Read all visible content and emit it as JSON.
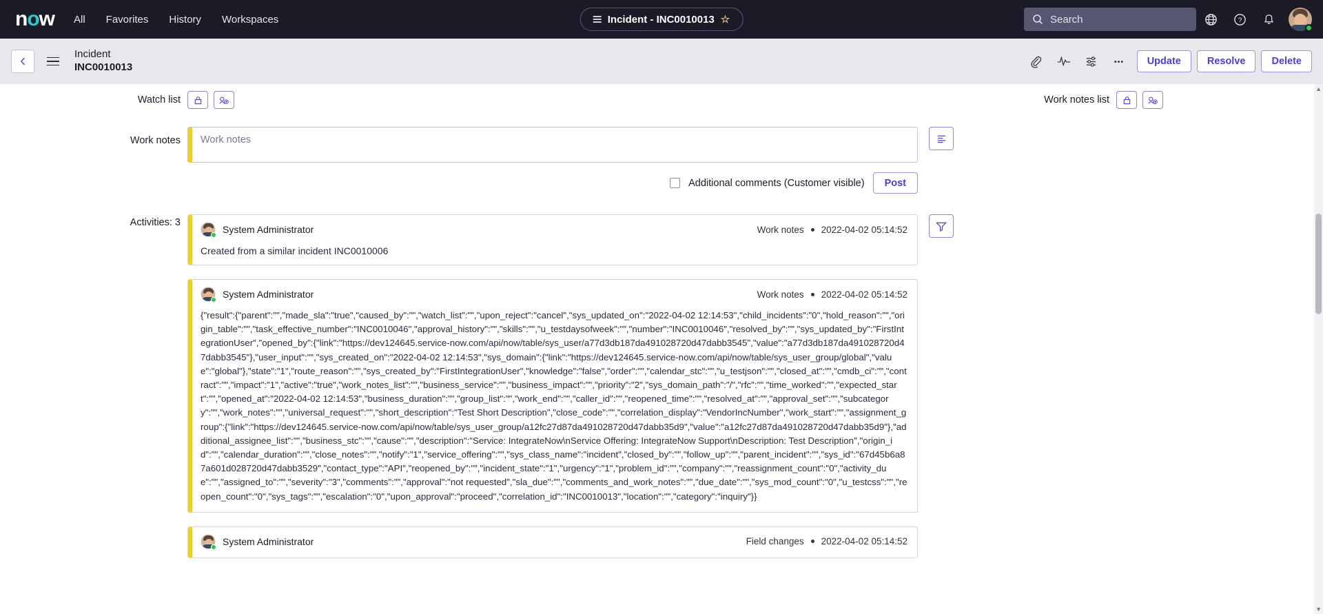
{
  "topnav": {
    "logo_text": "now",
    "links": [
      {
        "label": "All"
      },
      {
        "label": "Favorites"
      },
      {
        "label": "History"
      },
      {
        "label": "Workspaces"
      }
    ],
    "record_pill": {
      "menu_icon": "list-icon",
      "title": "Incident - INC0010013",
      "star_icon": "star-icon",
      "star_glyph": "☆"
    },
    "search": {
      "placeholder": "Search",
      "icon": "search-icon"
    },
    "icons": [
      {
        "name": "globe-icon"
      },
      {
        "name": "help-icon"
      },
      {
        "name": "notifications-bell-icon"
      }
    ],
    "avatar": {
      "name": "user-avatar",
      "status": "online"
    }
  },
  "subbar": {
    "back_icon": "chevron-left-icon",
    "menu_icon": "hamburger-menu-icon",
    "title_line1": "Incident",
    "title_line2": "INC0010013",
    "icons": [
      {
        "name": "attachment-paperclip-icon"
      },
      {
        "name": "activity-pulse-icon"
      },
      {
        "name": "personalize-sliders-icon"
      },
      {
        "name": "more-options-icon"
      }
    ],
    "buttons": [
      {
        "label": "Update",
        "name": "update-button"
      },
      {
        "label": "Resolve",
        "name": "resolve-button"
      },
      {
        "label": "Delete",
        "name": "delete-button"
      }
    ]
  },
  "form": {
    "watch_list_label": "Watch list",
    "work_notes_list_label": "Work notes list",
    "lock_icon": "lock-icon",
    "add_user_icon": "add-user-icon",
    "work_notes_label": "Work notes",
    "work_notes_placeholder": "Work notes",
    "work_notes_value": "",
    "format_icon": "text-format-icon",
    "additional_comments_label": "Additional comments (Customer visible)",
    "additional_comments_checked": false,
    "post_label": "Post"
  },
  "activities": {
    "label": "Activities: 3",
    "filter_icon": "filter-icon",
    "entries": [
      {
        "user": "System Administrator",
        "type": "Work notes",
        "timestamp": "2022-04-02 05:14:52",
        "text": "Created from a similar incident INC0010006",
        "json": ""
      },
      {
        "user": "System Administrator",
        "type": "Work notes",
        "timestamp": "2022-04-02 05:14:52",
        "text": "",
        "json": "{\"result\":{\"parent\":\"\",\"made_sla\":\"true\",\"caused_by\":\"\",\"watch_list\":\"\",\"upon_reject\":\"cancel\",\"sys_updated_on\":\"2022-04-02 12:14:53\",\"child_incidents\":\"0\",\"hold_reason\":\"\",\"origin_table\":\"\",\"task_effective_number\":\"INC0010046\",\"approval_history\":\"\",\"skills\":\"\",\"u_testdaysofweek\":\"\",\"number\":\"INC0010046\",\"resolved_by\":\"\",\"sys_updated_by\":\"FirstIntegrationUser\",\"opened_by\":{\"link\":\"https://dev124645.service-now.com/api/now/table/sys_user/a77d3db187da491028720d47dabb3545\",\"value\":\"a77d3db187da491028720d47dabb3545\"},\"user_input\":\"\",\"sys_created_on\":\"2022-04-02 12:14:53\",\"sys_domain\":{\"link\":\"https://dev124645.service-now.com/api/now/table/sys_user_group/global\",\"value\":\"global\"},\"state\":\"1\",\"route_reason\":\"\",\"sys_created_by\":\"FirstIntegrationUser\",\"knowledge\":\"false\",\"order\":\"\",\"calendar_stc\":\"\",\"u_testjson\":\"\",\"closed_at\":\"\",\"cmdb_ci\":\"\",\"contract\":\"\",\"impact\":\"1\",\"active\":\"true\",\"work_notes_list\":\"\",\"business_service\":\"\",\"business_impact\":\"\",\"priority\":\"2\",\"sys_domain_path\":\"/\",\"rfc\":\"\",\"time_worked\":\"\",\"expected_start\":\"\",\"opened_at\":\"2022-04-02 12:14:53\",\"business_duration\":\"\",\"group_list\":\"\",\"work_end\":\"\",\"caller_id\":\"\",\"reopened_time\":\"\",\"resolved_at\":\"\",\"approval_set\":\"\",\"subcategory\":\"\",\"work_notes\":\"\",\"universal_request\":\"\",\"short_description\":\"Test Short Description\",\"close_code\":\"\",\"correlation_display\":\"VendorIncNumber\",\"work_start\":\"\",\"assignment_group\":{\"link\":\"https://dev124645.service-now.com/api/now/table/sys_user_group/a12fc27d87da491028720d47dabb35d9\",\"value\":\"a12fc27d87da491028720d47dabb35d9\"},\"additional_assignee_list\":\"\",\"business_stc\":\"\",\"cause\":\"\",\"description\":\"Service: IntegrateNow\\nService Offering: IntegrateNow Support\\nDescription: Test Description\",\"origin_id\":\"\",\"calendar_duration\":\"\",\"close_notes\":\"\",\"notify\":\"1\",\"service_offering\":\"\",\"sys_class_name\":\"incident\",\"closed_by\":\"\",\"follow_up\":\"\",\"parent_incident\":\"\",\"sys_id\":\"67d45b6a87a601d028720d47dabb3529\",\"contact_type\":\"API\",\"reopened_by\":\"\",\"incident_state\":\"1\",\"urgency\":\"1\",\"problem_id\":\"\",\"company\":\"\",\"reassignment_count\":\"0\",\"activity_due\":\"\",\"assigned_to\":\"\",\"severity\":\"3\",\"comments\":\"\",\"approval\":\"not requested\",\"sla_due\":\"\",\"comments_and_work_notes\":\"\",\"due_date\":\"\",\"sys_mod_count\":\"0\",\"u_testcss\":\"\",\"reopen_count\":\"0\",\"sys_tags\":\"\",\"escalation\":\"0\",\"upon_approval\":\"proceed\",\"correlation_id\":\"INC0010013\",\"location\":\"\",\"category\":\"inquiry\"}}"
      },
      {
        "user": "System Administrator",
        "type": "Field changes",
        "timestamp": "2022-04-02 05:14:52",
        "text": "",
        "json": ""
      }
    ]
  },
  "colors": {
    "nav_bg": "#1b1b28",
    "accent_purple": "#4b3fcf",
    "accent_yellow": "#f5d018",
    "teal": "#32c8c8",
    "status_green": "#2bc84b"
  }
}
